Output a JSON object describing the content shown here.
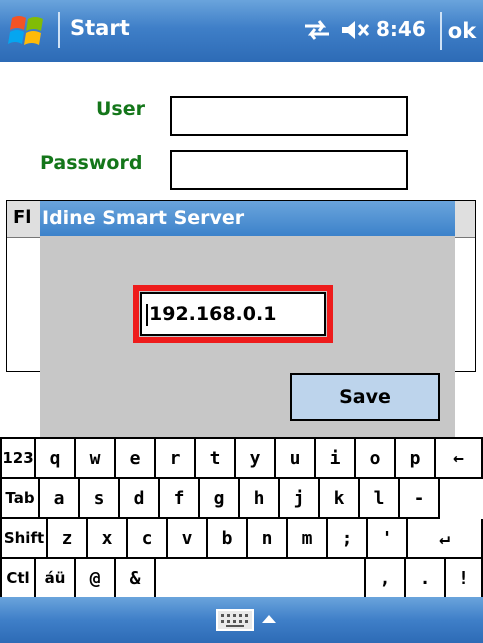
{
  "titlebar": {
    "title": "Start",
    "time": "8:46",
    "ok_label": "ok"
  },
  "login": {
    "user_label": "User",
    "password_label": "Password",
    "user_value": "",
    "password_value": ""
  },
  "grid": {
    "header_text": "Fl"
  },
  "dialog": {
    "title": "Idine Smart Server",
    "ip_value": "192.168.0.1",
    "save_label": "Save"
  },
  "keyboard": {
    "rows": [
      [
        "123",
        "q",
        "w",
        "e",
        "r",
        "t",
        "y",
        "u",
        "i",
        "o",
        "p",
        "←"
      ],
      [
        "Tab",
        "a",
        "s",
        "d",
        "f",
        "g",
        "h",
        "j",
        "k",
        "l",
        "-"
      ],
      [
        "Shift",
        "z",
        "x",
        "c",
        "v",
        "b",
        "n",
        "m",
        ";",
        "'",
        "↵"
      ],
      [
        "Ctl",
        "áü",
        "@",
        "&",
        "",
        ",",
        ".",
        "!",
        "?"
      ]
    ]
  },
  "colors": {
    "titlebar": "#3f7fc8",
    "label_green": "#14761a",
    "highlight_red": "#ee1c1c",
    "dialog_bg": "#c7c7c7",
    "save_bg": "#bdd4ec"
  },
  "icons": {
    "start": "windows-flag-icon",
    "sync": "sync-arrows-icon",
    "volume": "volume-muted-icon",
    "keyboard": "keyboard-icon",
    "arrow": "arrow-up-icon"
  }
}
